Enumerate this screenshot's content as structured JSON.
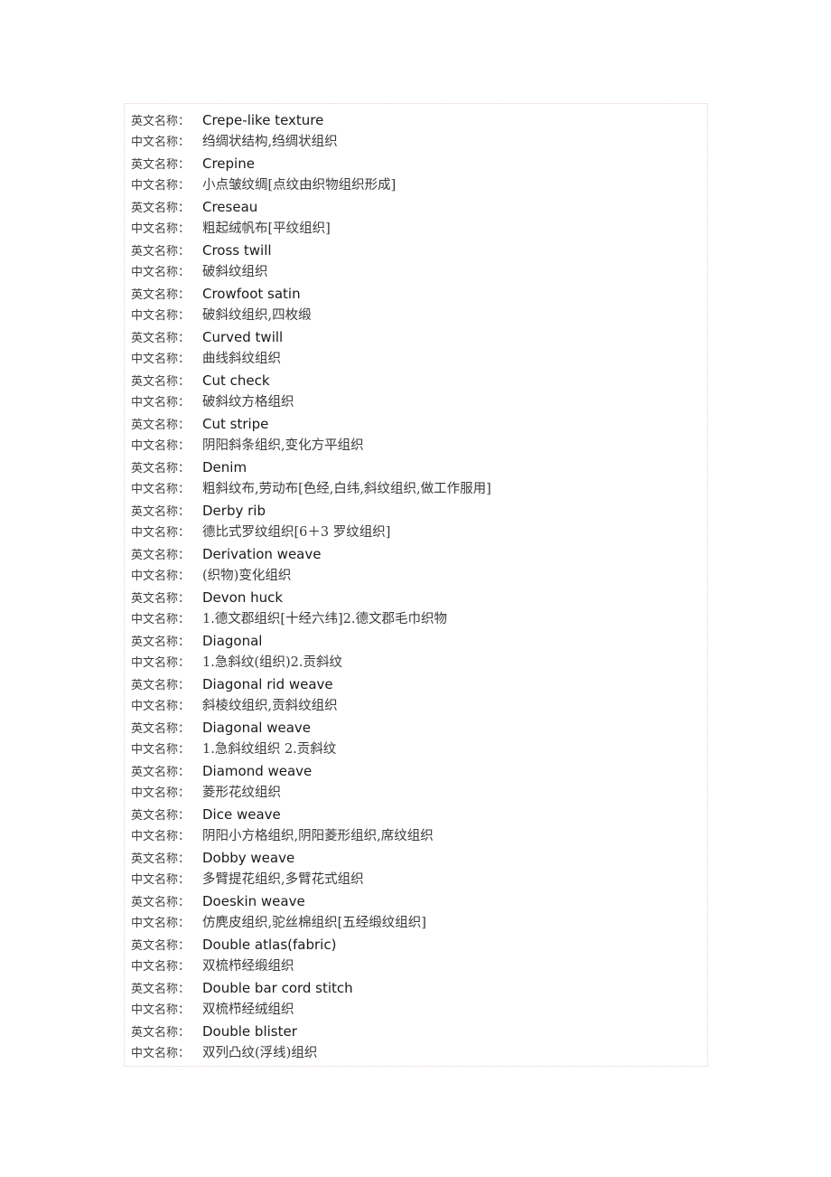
{
  "labels": {
    "english": "英文名称：",
    "chinese": "中文名称："
  },
  "frame": {
    "border_color": "#e7c9e0"
  },
  "entries": [
    {
      "english": "Crepe-like texture",
      "chinese": "绉绸状结构,绉绸状组织"
    },
    {
      "english": "Crepine",
      "chinese": "小点皱纹绸[点纹由织物组织形成]"
    },
    {
      "english": "Creseau",
      "chinese": "粗起绒帆布[平纹组织]"
    },
    {
      "english": "Cross twill",
      "chinese": "破斜纹组织"
    },
    {
      "english": "Crowfoot satin",
      "chinese": "破斜纹组织,四枚缎"
    },
    {
      "english": "Curved twill",
      "chinese": "曲线斜纹组织"
    },
    {
      "english": "Cut check",
      "chinese": "破斜纹方格组织"
    },
    {
      "english": "Cut stripe",
      "chinese": "阴阳斜条组织,变化方平组织"
    },
    {
      "english": "Denim",
      "chinese": "粗斜纹布,劳动布[色经,白纬,斜纹组织,做工作服用]"
    },
    {
      "english": "Derby rib",
      "chinese": "德比式罗纹组织[6＋3 罗纹组织]"
    },
    {
      "english": "Derivation weave",
      "chinese": "(织物)变化组织"
    },
    {
      "english": "Devon huck",
      "chinese": "1.德文郡组织[十经六纬]2.德文郡毛巾织物"
    },
    {
      "english": "Diagonal",
      "chinese": "1.急斜纹(组织)2.贡斜纹"
    },
    {
      "english": "Diagonal rid weave",
      "chinese": "斜棱纹组织,贡斜纹组织"
    },
    {
      "english": "Diagonal weave",
      "chinese": "1.急斜纹组织 2.贡斜纹"
    },
    {
      "english": "Diamond weave",
      "chinese": "菱形花纹组织"
    },
    {
      "english": "Dice weave",
      "chinese": "阴阳小方格组织,阴阳菱形组织,席纹组织"
    },
    {
      "english": "Dobby weave",
      "chinese": "多臂提花组织,多臂花式组织"
    },
    {
      "english": "Doeskin weave",
      "chinese": "仿麂皮组织,驼丝棉组织[五经缎纹组织]"
    },
    {
      "english": "Double atlas(fabric)",
      "chinese": "双梳栉经缎组织"
    },
    {
      "english": "Double bar cord stitch",
      "chinese": "双梳栉经绒组织"
    },
    {
      "english": "Double blister",
      "chinese": "双列凸纹(浮线)组织"
    }
  ]
}
